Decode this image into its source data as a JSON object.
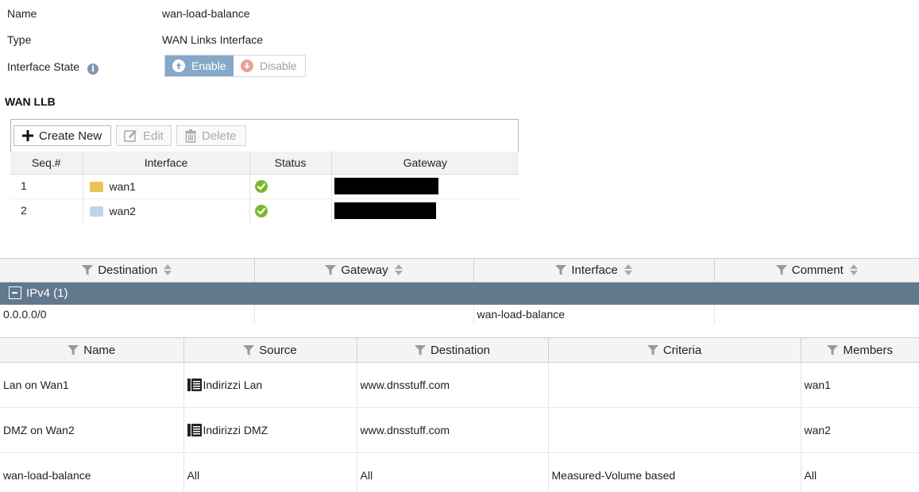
{
  "properties": {
    "name_label": "Name",
    "name_value": "wan-load-balance",
    "type_label": "Type",
    "type_value": "WAN Links Interface",
    "state_label": "Interface State",
    "enable_label": "Enable",
    "disable_label": "Disable",
    "state_selected": "Enable"
  },
  "wan_llb": {
    "title": "WAN LLB",
    "toolbar": {
      "create": "Create New",
      "edit": "Edit",
      "delete": "Delete"
    },
    "columns": [
      "Seq.#",
      "Interface",
      "Status",
      "Gateway"
    ],
    "rows": [
      {
        "seq": "1",
        "interface": "wan1",
        "swatch_color": "#e9c45a",
        "status": "ok",
        "gateway": ""
      },
      {
        "seq": "2",
        "interface": "wan2",
        "swatch_color": "#bcd6ef",
        "status": "ok",
        "gateway": ""
      }
    ]
  },
  "routes": {
    "columns": [
      "Destination",
      "Gateway",
      "Interface",
      "Comment"
    ],
    "group_label": "IPv4 (1)",
    "rows": [
      {
        "destination": "0.0.0.0/0",
        "gateway": "",
        "interface": "wan-load-balance",
        "comment": ""
      }
    ]
  },
  "rules": {
    "columns": [
      "Name",
      "Source",
      "Destination",
      "Criteria",
      "Members"
    ],
    "rows": [
      {
        "name": "Lan on Wan1",
        "source": "Indirizzi Lan",
        "source_icon": "address-group-icon",
        "destination": "www.dnsstuff.com",
        "criteria": "",
        "members": "wan1"
      },
      {
        "name": "DMZ on Wan2",
        "source": "Indirizzi DMZ",
        "source_icon": "address-group-icon",
        "destination": "www.dnsstuff.com",
        "criteria": "",
        "members": "wan2"
      },
      {
        "name": "wan-load-balance",
        "source": "All",
        "source_icon": "",
        "destination": "All",
        "criteria": "Measured-Volume based",
        "members": "All"
      }
    ]
  },
  "colors": {
    "enable_active": "#86a8c8",
    "group_header": "#62788c",
    "status_ok": "#7cb82f"
  }
}
